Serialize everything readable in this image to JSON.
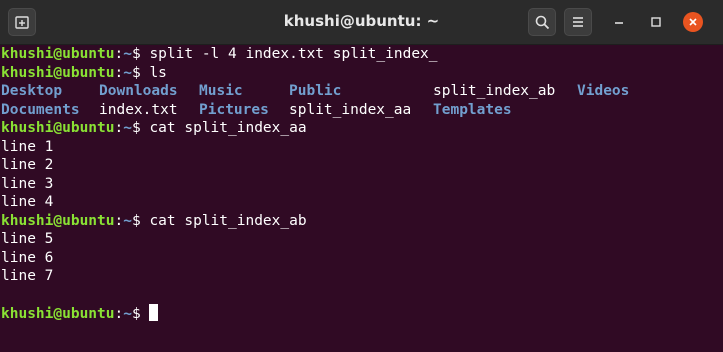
{
  "window": {
    "title": "khushi@ubuntu: ~"
  },
  "prompt": {
    "user_host": "khushi@ubuntu",
    "sep": ":",
    "path": "~",
    "dollar": "$ "
  },
  "commands": [
    "split -l 4 index.txt split_index_",
    "ls",
    "cat split_index_aa",
    "cat split_index_ab"
  ],
  "ls_output": {
    "row1": [
      {
        "name": "Desktop",
        "type": "dir"
      },
      {
        "name": "Downloads",
        "type": "dir"
      },
      {
        "name": "Music",
        "type": "dir"
      },
      {
        "name": "Public",
        "type": "dir"
      },
      {
        "name": "split_index_ab",
        "type": "file"
      },
      {
        "name": "Videos",
        "type": "dir"
      }
    ],
    "row2": [
      {
        "name": "Documents",
        "type": "dir"
      },
      {
        "name": "index.txt",
        "type": "file"
      },
      {
        "name": "Pictures",
        "type": "dir"
      },
      {
        "name": "split_index_aa",
        "type": "file"
      },
      {
        "name": "Templates",
        "type": "dir"
      }
    ]
  },
  "cat_aa_output": [
    "line 1",
    "line 2",
    "line 3",
    "line 4"
  ],
  "cat_ab_output": [
    "line 5",
    "line 6",
    "line 7"
  ],
  "colors": {
    "background": "#300a24",
    "user_host": "#8ae234",
    "path": "#729fcf",
    "directory": "#729fcf",
    "close_button": "#e95420"
  },
  "icons": {
    "new_tab": "new-tab-icon",
    "search": "search-icon",
    "menu": "hamburger-menu-icon",
    "minimize": "minimize-icon",
    "maximize": "maximize-icon",
    "close": "close-icon"
  }
}
